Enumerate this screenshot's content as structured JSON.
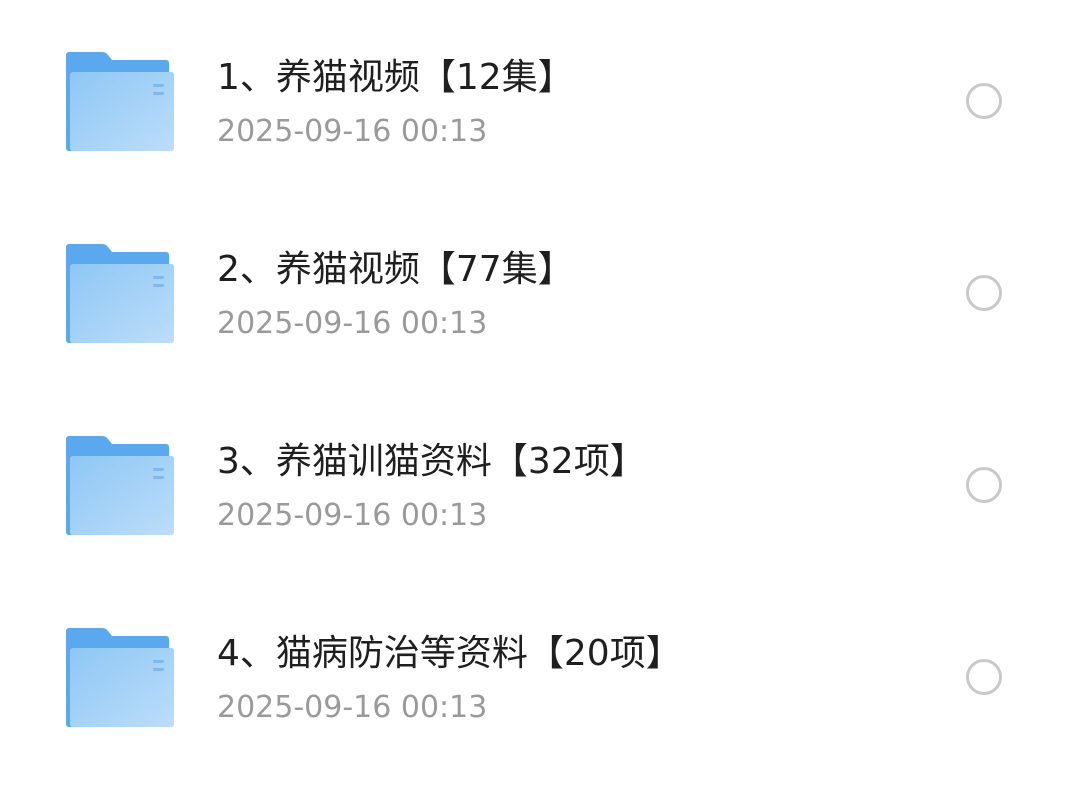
{
  "files": [
    {
      "name": "1、养猫视频【12集】",
      "time": "2025-09-16 00:13",
      "icon": "folder-icon"
    },
    {
      "name": "2、养猫视频【77集】",
      "time": "2025-09-16 00:13",
      "icon": "folder-icon"
    },
    {
      "name": "3、养猫训猫资料【32项】",
      "time": "2025-09-16 00:13",
      "icon": "folder-icon"
    },
    {
      "name": "4、猫病防治等资料【20项】",
      "time": "2025-09-16 00:13",
      "icon": "folder-icon"
    }
  ],
  "colors": {
    "folder_back": "#5AA8EE",
    "folder_front_start": "#8EC7F5",
    "folder_front_end": "#B7DBF9",
    "name_text": "#1F1F1F",
    "time_text": "#9A9A9A",
    "radio_border": "#C9C9CC"
  }
}
